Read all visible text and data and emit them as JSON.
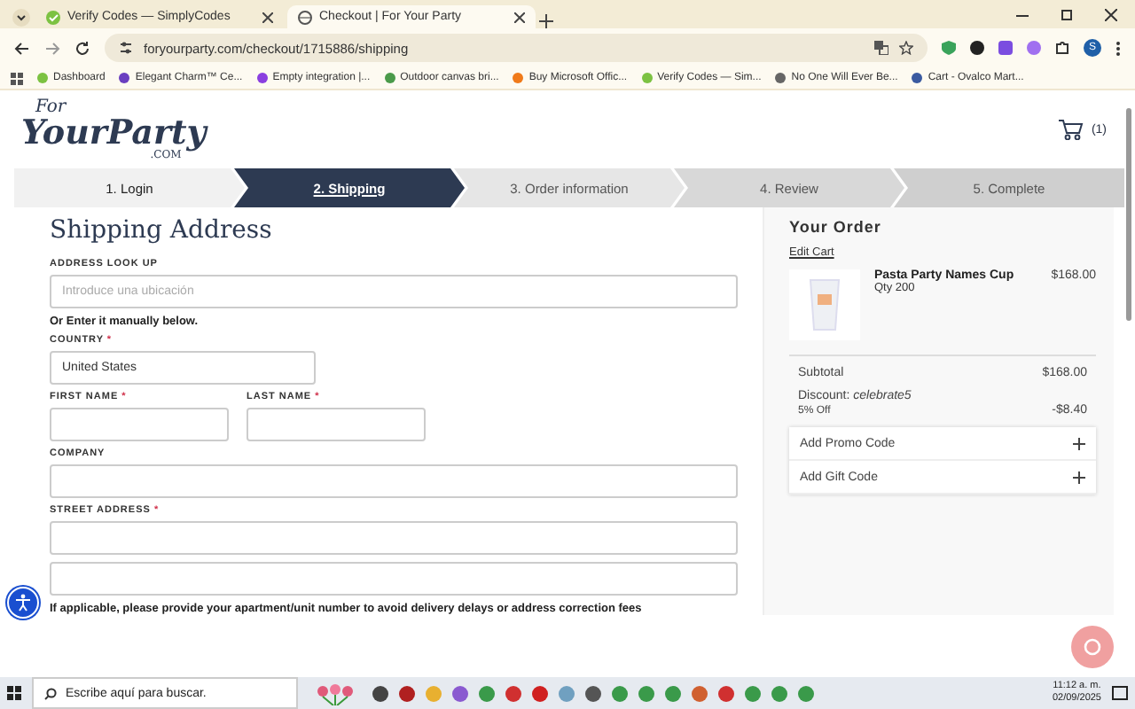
{
  "browser": {
    "tabs": [
      {
        "title": "Verify Codes — SimplyCodes",
        "selected": false
      },
      {
        "title": "Checkout | For Your Party",
        "selected": true
      }
    ],
    "url": "foryourparty.com/checkout/1715886/shipping",
    "bookmarks": [
      "Dashboard",
      "Elegant Charm™ Ce...",
      "Empty integration |...",
      "Outdoor canvas bri...",
      "Buy Microsoft Offic...",
      "Verify Codes — Sim...",
      "No One Will Ever Be...",
      "Cart - Ovalco Mart..."
    ],
    "profile_initial": "S"
  },
  "header": {
    "logo": [
      "For",
      "YourParty",
      ".COM"
    ],
    "cart_count": "(1)"
  },
  "steps": [
    {
      "label": "1. Login",
      "selected": false
    },
    {
      "label": "2. Shipping",
      "selected": true
    },
    {
      "label": "3. Order information",
      "selected": false
    },
    {
      "label": "4. Review",
      "selected": false
    },
    {
      "label": "5. Complete",
      "selected": false
    }
  ],
  "shipping": {
    "title": "Shipping Address",
    "rows": [
      {
        "kind": "fields",
        "fields": [
          {
            "label": "ADDRESS LOOK UP",
            "placeholder": "Introduce una ubicación",
            "kind": "wide"
          }
        ]
      },
      {
        "kind": "note",
        "text": "Or Enter it manually below."
      },
      {
        "kind": "fields",
        "fields": [
          {
            "label": "COUNTRY",
            "required_mark": "*",
            "value": "United States",
            "kind": "medium"
          }
        ]
      },
      {
        "kind": "fields",
        "fields": [
          {
            "label": "FIRST NAME",
            "required_mark": "*",
            "kind": "narrow"
          },
          {
            "label": "LAST NAME",
            "required_mark": "*",
            "kind": "narrow"
          }
        ]
      },
      {
        "kind": "fields",
        "fields": [
          {
            "label": "COMPANY",
            "kind": "wide"
          }
        ]
      },
      {
        "kind": "fields",
        "fields": [
          {
            "label": "STREET ADDRESS",
            "required_mark": "*",
            "kind": "wide"
          }
        ]
      },
      {
        "kind": "fields",
        "fields": [
          {
            "kind": "wide"
          }
        ]
      },
      {
        "kind": "note",
        "text": "If applicable, please provide your apartment/unit number to avoid delivery delays or address correction fees"
      }
    ]
  },
  "order": {
    "title": "Your Order",
    "edit_link": "Edit Cart",
    "item": {
      "name": "Pasta Party Names Cup",
      "qty": "Qty 200",
      "price": "$168.00"
    },
    "subtotal": {
      "label": "Subtotal",
      "value": "$168.00"
    },
    "discount": {
      "label": "Discount: *celebrate5*",
      "note": "5% Off",
      "value": "-$8.40"
    },
    "accordions": [
      {
        "label": "Add Promo Code",
        "expanded": false
      },
      {
        "label": "Add Gift Code",
        "expanded": false
      }
    ]
  },
  "taskbar": {
    "search_placeholder": "Escribe aquí para buscar.",
    "time": "11:12 a. m.",
    "date": "02/09/2025"
  }
}
